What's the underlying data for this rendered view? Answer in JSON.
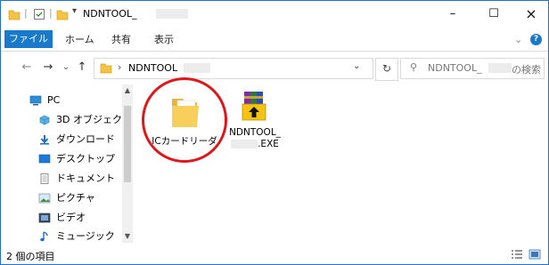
{
  "window": {
    "title": "NDNTOOL_",
    "minimize_glyph": "–",
    "maximize_glyph": "☐",
    "close_glyph": "×"
  },
  "quick_access": {
    "separator": "|",
    "dropdown_glyph": "▾"
  },
  "ribbon": {
    "tabs": [
      "ファイル",
      "ホーム",
      "共有",
      "表示"
    ],
    "expand_glyph": "⌄",
    "help_glyph": "?"
  },
  "address": {
    "back_glyph": "←",
    "forward_glyph": "→",
    "recent_glyph": "⌄",
    "up_glyph": "↑",
    "crumb_separator": "›",
    "path_text": "NDNTOOL",
    "dropdown_glyph": "⌄",
    "refresh_glyph": "↻"
  },
  "search": {
    "icon_glyph": "⚲",
    "placeholder_prefix": "NDNTOOL_",
    "placeholder_suffix": "の検索"
  },
  "sidebar": {
    "items": [
      {
        "label": "PC",
        "icon": "pc-icon"
      },
      {
        "label": "3D オブジェクト",
        "icon": "3d-objects-icon"
      },
      {
        "label": "ダウンロード",
        "icon": "download-icon"
      },
      {
        "label": "デスクトップ",
        "icon": "desktop-icon"
      },
      {
        "label": "ドキュメント",
        "icon": "documents-icon"
      },
      {
        "label": "ピクチャ",
        "icon": "pictures-icon"
      },
      {
        "label": "ビデオ",
        "icon": "videos-icon"
      },
      {
        "label": "ミュージック",
        "icon": "music-icon"
      }
    ],
    "scroll_up_glyph": "▲",
    "scroll_down_glyph": "▼"
  },
  "files": [
    {
      "name": "ICカードリーダ",
      "type": "folder",
      "highlighted": true
    },
    {
      "name_line1": "NDNTOOL_",
      "name_line2": ".EXE",
      "type": "installer"
    }
  ],
  "status": {
    "item_count": "2 個の項目"
  },
  "colors": {
    "accent": "#1979ca",
    "highlight_circle": "#e0161b",
    "folder": "#f4c342"
  }
}
